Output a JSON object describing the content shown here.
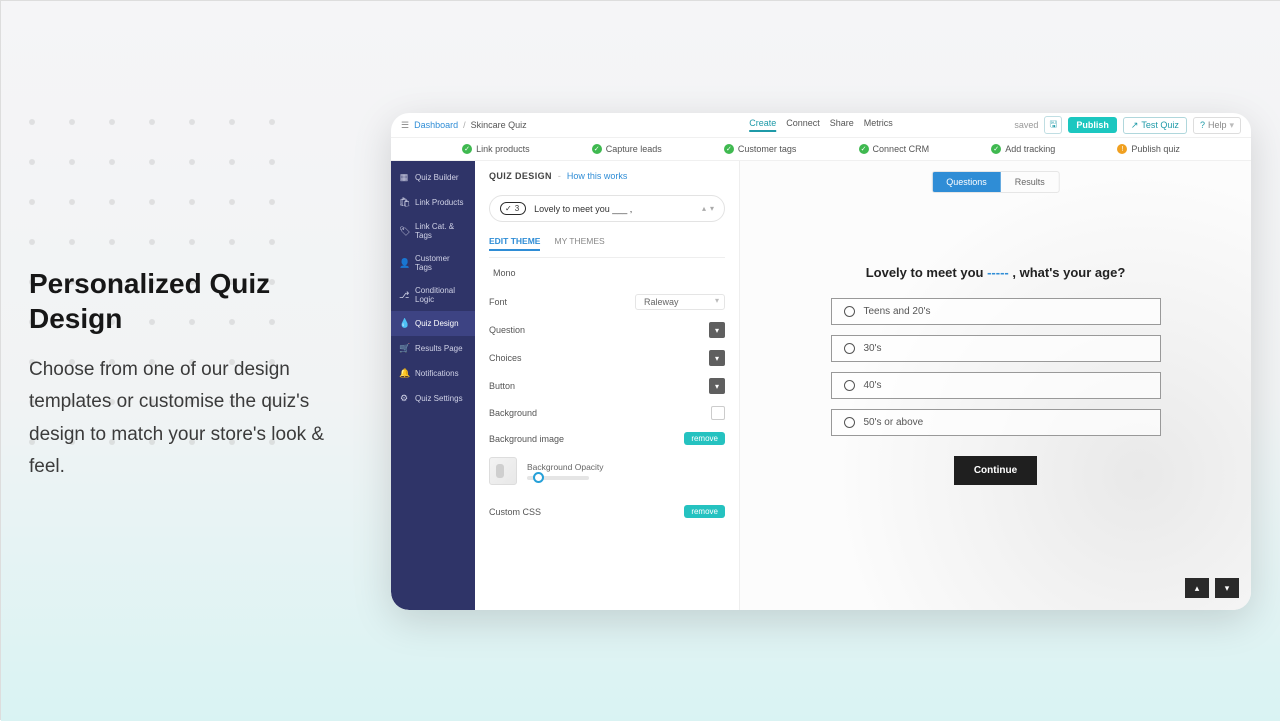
{
  "marketing": {
    "title": "Personalized Quiz Design",
    "body": "Choose from one of our design templates or customise the quiz's design to match your store's look & feel."
  },
  "breadcrumb": {
    "link": "Dashboard",
    "current": "Skincare Quiz"
  },
  "topnav": {
    "create": "Create",
    "connect": "Connect",
    "share": "Share",
    "metrics": "Metrics"
  },
  "actions": {
    "saved": "saved",
    "publish": "Publish",
    "test": "Test Quiz",
    "help": "Help"
  },
  "steps": {
    "link_products": "Link products",
    "capture_leads": "Capture leads",
    "customer_tags": "Customer tags",
    "connect_crm": "Connect CRM",
    "add_tracking": "Add tracking",
    "publish_quiz": "Publish quiz"
  },
  "sidebar": {
    "quiz_builder": "Quiz Builder",
    "link_products": "Link Products",
    "link_cat_tags": "Link Cat. & Tags",
    "customer_tags": "Customer Tags",
    "conditional_logic": "Conditional Logic",
    "quiz_design": "Quiz Design",
    "results_page": "Results Page",
    "notifications": "Notifications",
    "quiz_settings": "Quiz Settings"
  },
  "design_panel": {
    "heading": "QUIZ DESIGN",
    "how": "How this works",
    "question_badge_num": "3",
    "question_title": "Lovely to meet you ___ ,",
    "tab_edit": "EDIT THEME",
    "tab_my": "MY THEMES",
    "mono": "Mono",
    "font_label": "Font",
    "font_value": "Raleway",
    "question_label": "Question",
    "choices_label": "Choices",
    "button_label": "Button",
    "background_label": "Background",
    "bg_image_label": "Background image",
    "bg_opacity_label": "Background Opacity",
    "custom_css_label": "Custom CSS",
    "remove": "remove"
  },
  "preview": {
    "tab_questions": "Questions",
    "tab_results": "Results",
    "title_pre": "Lovely to meet you ",
    "title_fill": "-----",
    "title_post": " , what's your age?",
    "options": [
      "Teens and 20's",
      "30's",
      "40's",
      "50's or above"
    ],
    "continue": "Continue"
  }
}
